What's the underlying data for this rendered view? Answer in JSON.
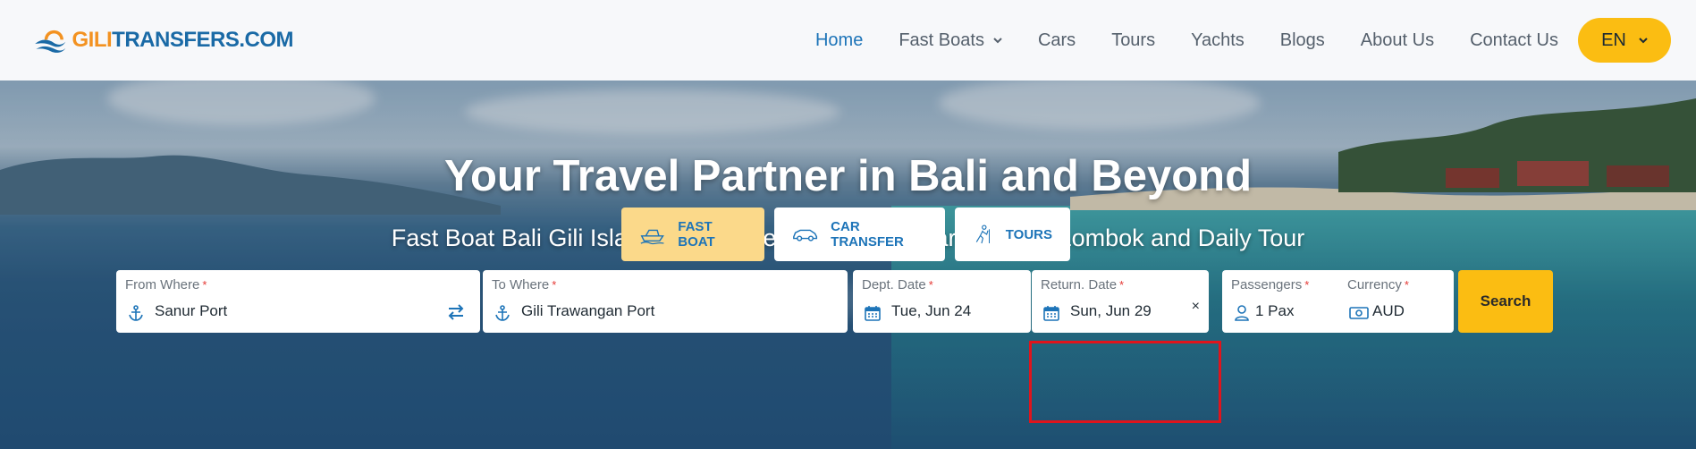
{
  "logo": {
    "part1": "GILI",
    "part2": "TRANSFERS.COM"
  },
  "nav": {
    "items": [
      {
        "label": "Home",
        "active": true
      },
      {
        "label": "Fast Boats",
        "dropdown": true
      },
      {
        "label": "Cars"
      },
      {
        "label": "Tours"
      },
      {
        "label": "Yachts"
      },
      {
        "label": "Blogs"
      },
      {
        "label": "About Us"
      },
      {
        "label": "Contact Us"
      }
    ],
    "language": "EN"
  },
  "hero": {
    "title": "Your Travel Partner in Bali and Beyond",
    "subtitle": "Fast Boat Bali Gili Island & Nusa Penida, Private Car in Bali & Lombok and Daily Tour"
  },
  "tabs": [
    {
      "label": "FAST BOAT",
      "active": true,
      "icon": "boat-icon"
    },
    {
      "label": "CAR TRANSFER",
      "icon": "car-icon"
    },
    {
      "label": "TOURS",
      "icon": "hiker-icon"
    }
  ],
  "search": {
    "from": {
      "label": "From Where",
      "required": "*",
      "value": "Sanur Port"
    },
    "to": {
      "label": "To Where",
      "required": "*",
      "value": "Gili Trawangan Port"
    },
    "dept": {
      "label": "Dept. Date",
      "required": "*",
      "value": "Tue, Jun 24"
    },
    "ret": {
      "label": "Return. Date",
      "required": "*",
      "value": "Sun, Jun 29",
      "clear": "×"
    },
    "passengers": {
      "label": "Passengers",
      "required": "*",
      "value": "1 Pax"
    },
    "currency": {
      "label": "Currency",
      "required": "*",
      "value": "AUD"
    },
    "button": "Search"
  },
  "colors": {
    "accent": "#fbbd12",
    "brand_blue": "#1d74b8",
    "highlight": "#e0141c"
  }
}
